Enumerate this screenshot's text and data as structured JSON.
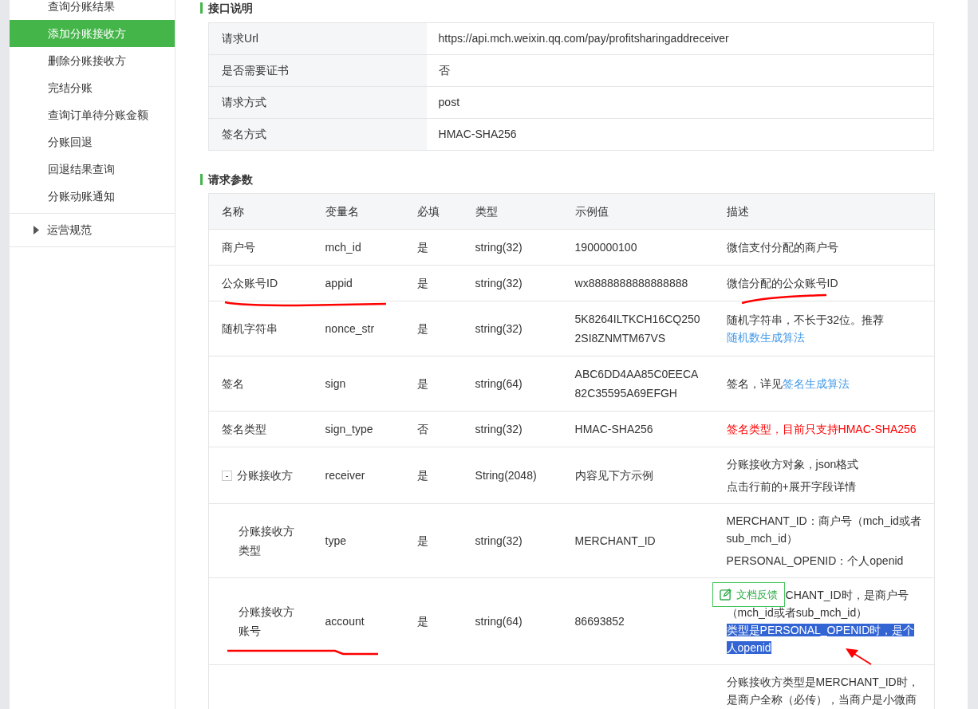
{
  "sidebar": {
    "items": [
      {
        "label": "查询分账结果",
        "selected": false
      },
      {
        "label": "添加分账接收方",
        "selected": true
      },
      {
        "label": "删除分账接收方",
        "selected": false
      },
      {
        "label": "完结分账",
        "selected": false
      },
      {
        "label": "查询订单待分账金额",
        "selected": false
      },
      {
        "label": "分账回退",
        "selected": false
      },
      {
        "label": "回退结果查询",
        "selected": false
      },
      {
        "label": "分账动账通知",
        "selected": false
      }
    ],
    "sections": [
      {
        "label": "运营规范",
        "expanded": false
      }
    ]
  },
  "api_info": {
    "title": "接口说明",
    "rows": [
      {
        "label": "请求Url",
        "value": "https://api.mch.weixin.qq.com/pay/profitsharingaddreceiver"
      },
      {
        "label": "是否需要证书",
        "value": "否"
      },
      {
        "label": "请求方式",
        "value": "post"
      },
      {
        "label": "签名方式",
        "value": "HMAC-SHA256"
      }
    ]
  },
  "params": {
    "title": "请求参数",
    "columns": [
      "名称",
      "变量名",
      "必填",
      "类型",
      "示例值",
      "描述"
    ],
    "rows": [
      {
        "name": "商户号",
        "variable": "mch_id",
        "required": "是",
        "type": "string(32)",
        "example": "1900000100",
        "description": [
          [
            {
              "kind": "text",
              "text": "微信支付分配的商户号"
            }
          ]
        ]
      },
      {
        "name": "公众账号ID",
        "variable": "appid",
        "required": "是",
        "type": "string(32)",
        "example": "wx8888888888888888",
        "description": [
          [
            {
              "kind": "text",
              "text": "微信分配的公众账号ID"
            }
          ]
        ]
      },
      {
        "name": "随机字符串",
        "variable": "nonce_str",
        "required": "是",
        "type": "string(32)",
        "example": "5K8264ILTKCH16CQ2502SI8ZNMTM67VS",
        "description": [
          [
            {
              "kind": "text",
              "text": "随机字符串，不长于32位。推荐"
            },
            {
              "kind": "link",
              "text": "随机数生成算法"
            }
          ]
        ]
      },
      {
        "name": "签名",
        "variable": "sign",
        "required": "是",
        "type": "string(64)",
        "example": "ABC6DD4AA85C0EECA82C35595A69EFGH",
        "description": [
          [
            {
              "kind": "text",
              "text": "签名，详见"
            },
            {
              "kind": "link",
              "text": "签名生成算法"
            }
          ]
        ]
      },
      {
        "name": "签名类型",
        "variable": "sign_type",
        "required": "否",
        "type": "string(32)",
        "example": "HMAC-SHA256",
        "description": [
          [
            {
              "kind": "warning",
              "text": "签名类型，目前只支持HMAC-SHA256"
            }
          ]
        ]
      },
      {
        "name": "分账接收方",
        "variable": "receiver",
        "required": "是",
        "type": "String(2048)",
        "example": "内容见下方示例",
        "expanded": true,
        "toggle": "-",
        "description": [
          [
            {
              "kind": "text",
              "text": "分账接收方对象，json格式"
            }
          ],
          [
            {
              "kind": "text",
              "text": "点击行前的+展开字段详情"
            }
          ]
        ],
        "children": [
          {
            "name": "分账接收方类型",
            "variable": "type",
            "required": "是",
            "type": "string(32)",
            "example": "MERCHANT_ID",
            "description": [
              [
                {
                  "kind": "text",
                  "text": "MERCHANT_ID：商户号（mch_id或者sub_mch_id）"
                }
              ],
              [
                {
                  "kind": "text",
                  "text": "PERSONAL_OPENID：个人openid"
                }
              ]
            ]
          },
          {
            "name": "分账接收方账号",
            "variable": "account",
            "required": "是",
            "type": "string(64)",
            "example": "86693852",
            "feedback": "文档反馈",
            "description": [
              [
                {
                  "kind": "text",
                  "text": "CHANT_ID时，是商户号"
                }
              ],
              [
                {
                  "kind": "text",
                  "text": "（mch_id或者sub_mch_id）"
                }
              ],
              [
                {
                  "kind": "highlight",
                  "text": "类型是PERSONAL_OPENID时，是个人openid"
                }
              ]
            ]
          },
          {
            "description": [
              [
                {
                  "kind": "text",
                  "text": "分账接收方类型是MERCHANT_ID时，是商户全称（必传），当商户是小微商"
                }
              ]
            ]
          }
        ]
      }
    ]
  }
}
